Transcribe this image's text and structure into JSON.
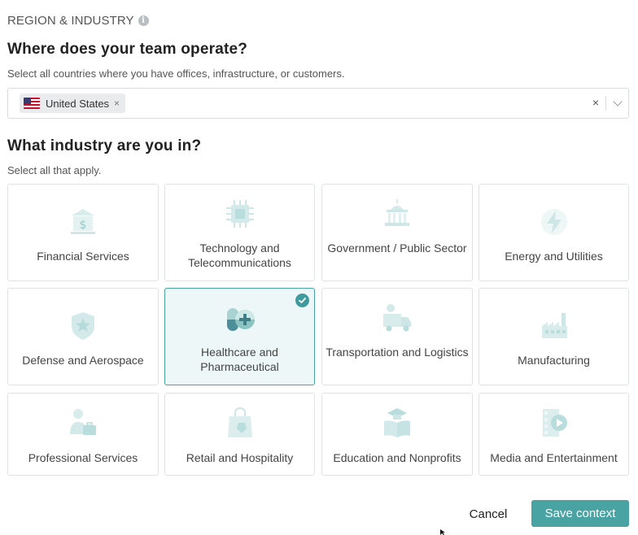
{
  "section": {
    "label": "REGION & INDUSTRY",
    "info_icon": "info-icon"
  },
  "region": {
    "question": "Where does your team operate?",
    "subtitle": "Select all countries where you have offices, infrastructure, or customers.",
    "selected_country": "United States",
    "chip_remove": "×",
    "clear_all": "×"
  },
  "industry": {
    "question": "What industry are you in?",
    "subtitle": "Select all that apply.",
    "tiles": [
      {
        "label": "Financial Services",
        "icon": "bank-icon",
        "selected": false
      },
      {
        "label": "Technology and Telecommunications",
        "icon": "chip-icon",
        "selected": false
      },
      {
        "label": "Government / Public Sector",
        "icon": "government-building-icon",
        "selected": false
      },
      {
        "label": "Energy and Utilities",
        "icon": "lightning-icon",
        "selected": false
      },
      {
        "label": "Defense and Aerospace",
        "icon": "shield-star-icon",
        "selected": false
      },
      {
        "label": "Healthcare and Pharmaceutical",
        "icon": "pill-medical-icon",
        "selected": true
      },
      {
        "label": "Transportation and Logistics",
        "icon": "delivery-truck-icon",
        "selected": false
      },
      {
        "label": "Manufacturing",
        "icon": "factory-icon",
        "selected": false
      },
      {
        "label": "Professional Services",
        "icon": "professional-briefcase-icon",
        "selected": false
      },
      {
        "label": "Retail and Hospitality",
        "icon": "shopping-bag-icon",
        "selected": false
      },
      {
        "label": "Education and Nonprofits",
        "icon": "graduation-book-icon",
        "selected": false
      },
      {
        "label": "Media and Entertainment",
        "icon": "media-play-icon",
        "selected": false
      }
    ]
  },
  "actions": {
    "cancel": "Cancel",
    "save": "Save context"
  },
  "colors": {
    "accent": "#4aa3a3",
    "icon_faded": "#cfe6e6",
    "selected_bg": "#edf7f7"
  }
}
